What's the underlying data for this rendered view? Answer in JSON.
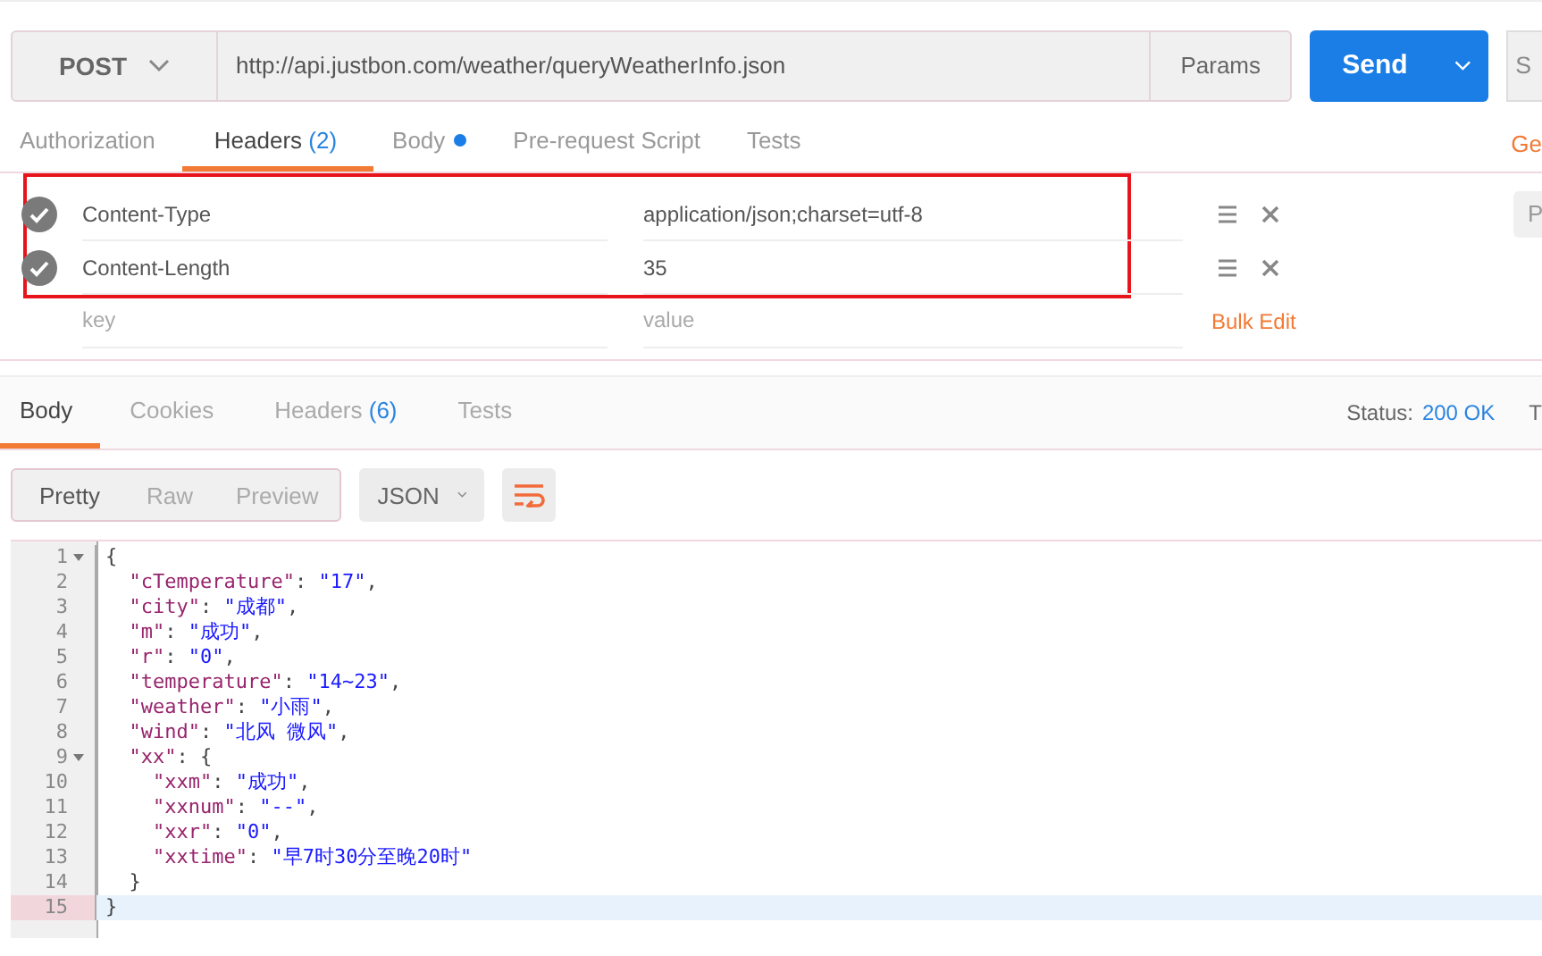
{
  "request": {
    "method": "POST",
    "url": "http://api.justbon.com/weather/queryWeatherInfo.json",
    "params_button": "Params",
    "send_button": "Send",
    "cut_button": "S"
  },
  "request_tabs": [
    {
      "label": "Authorization",
      "selected": false
    },
    {
      "label": "Headers",
      "count": "(2)",
      "selected": true
    },
    {
      "label": "Body",
      "dot": true,
      "selected": false
    },
    {
      "label": "Pre-request Script",
      "selected": false
    },
    {
      "label": "Tests",
      "selected": false
    }
  ],
  "generate_link": "Ge",
  "headers": [
    {
      "key": "Content-Type",
      "value": "application/json;charset=utf-8",
      "checked": true
    },
    {
      "key": "Content-Length",
      "value": "35",
      "checked": true
    }
  ],
  "new_header": {
    "key_placeholder": "key",
    "value_placeholder": "value"
  },
  "bulk_edit": "Bulk Edit",
  "side_button": "P",
  "response_tabs": [
    {
      "label": "Body",
      "selected": true
    },
    {
      "label": "Cookies",
      "selected": false
    },
    {
      "label": "Headers",
      "count": "(6)",
      "selected": false
    },
    {
      "label": "Tests",
      "selected": false
    }
  ],
  "status": {
    "label": "Status:",
    "value": "200 OK",
    "cut": "T"
  },
  "view_modes": [
    {
      "label": "Pretty",
      "selected": true
    },
    {
      "label": "Raw",
      "selected": false
    },
    {
      "label": "Preview",
      "selected": false
    }
  ],
  "format": "JSON",
  "code": [
    {
      "number": "1",
      "foldable": true,
      "selected": false,
      "tokens": [
        {
          "kind": "punct",
          "text": "{"
        }
      ]
    },
    {
      "number": "2",
      "foldable": false,
      "selected": false,
      "tokens": [
        {
          "kind": "key",
          "text": "  \"cTemperature\""
        },
        {
          "kind": "punct",
          "text": ": "
        },
        {
          "kind": "string",
          "text": "\"17\""
        },
        {
          "kind": "punct",
          "text": ","
        }
      ]
    },
    {
      "number": "3",
      "foldable": false,
      "selected": false,
      "tokens": [
        {
          "kind": "key",
          "text": "  \"city\""
        },
        {
          "kind": "punct",
          "text": ": "
        },
        {
          "kind": "string",
          "text": "\"成都\""
        },
        {
          "kind": "punct",
          "text": ","
        }
      ]
    },
    {
      "number": "4",
      "foldable": false,
      "selected": false,
      "tokens": [
        {
          "kind": "key",
          "text": "  \"m\""
        },
        {
          "kind": "punct",
          "text": ": "
        },
        {
          "kind": "string",
          "text": "\"成功\""
        },
        {
          "kind": "punct",
          "text": ","
        }
      ]
    },
    {
      "number": "5",
      "foldable": false,
      "selected": false,
      "tokens": [
        {
          "kind": "key",
          "text": "  \"r\""
        },
        {
          "kind": "punct",
          "text": ": "
        },
        {
          "kind": "string",
          "text": "\"0\""
        },
        {
          "kind": "punct",
          "text": ","
        }
      ]
    },
    {
      "number": "6",
      "foldable": false,
      "selected": false,
      "tokens": [
        {
          "kind": "key",
          "text": "  \"temperature\""
        },
        {
          "kind": "punct",
          "text": ": "
        },
        {
          "kind": "string",
          "text": "\"14~23\""
        },
        {
          "kind": "punct",
          "text": ","
        }
      ]
    },
    {
      "number": "7",
      "foldable": false,
      "selected": false,
      "tokens": [
        {
          "kind": "key",
          "text": "  \"weather\""
        },
        {
          "kind": "punct",
          "text": ": "
        },
        {
          "kind": "string",
          "text": "\"小雨\""
        },
        {
          "kind": "punct",
          "text": ","
        }
      ]
    },
    {
      "number": "8",
      "foldable": false,
      "selected": false,
      "tokens": [
        {
          "kind": "key",
          "text": "  \"wind\""
        },
        {
          "kind": "punct",
          "text": ": "
        },
        {
          "kind": "string",
          "text": "\"北风 微风\""
        },
        {
          "kind": "punct",
          "text": ","
        }
      ]
    },
    {
      "number": "9",
      "foldable": true,
      "selected": false,
      "tokens": [
        {
          "kind": "key",
          "text": "  \"xx\""
        },
        {
          "kind": "punct",
          "text": ": {"
        }
      ]
    },
    {
      "number": "10",
      "foldable": false,
      "selected": false,
      "tokens": [
        {
          "kind": "key",
          "text": "    \"xxm\""
        },
        {
          "kind": "punct",
          "text": ": "
        },
        {
          "kind": "string",
          "text": "\"成功\""
        },
        {
          "kind": "punct",
          "text": ","
        }
      ]
    },
    {
      "number": "11",
      "foldable": false,
      "selected": false,
      "tokens": [
        {
          "kind": "key",
          "text": "    \"xxnum\""
        },
        {
          "kind": "punct",
          "text": ": "
        },
        {
          "kind": "string",
          "text": "\"--\""
        },
        {
          "kind": "punct",
          "text": ","
        }
      ]
    },
    {
      "number": "12",
      "foldable": false,
      "selected": false,
      "tokens": [
        {
          "kind": "key",
          "text": "    \"xxr\""
        },
        {
          "kind": "punct",
          "text": ": "
        },
        {
          "kind": "string",
          "text": "\"0\""
        },
        {
          "kind": "punct",
          "text": ","
        }
      ]
    },
    {
      "number": "13",
      "foldable": false,
      "selected": false,
      "tokens": [
        {
          "kind": "key",
          "text": "    \"xxtime\""
        },
        {
          "kind": "punct",
          "text": ": "
        },
        {
          "kind": "string",
          "text": "\"早7时30分至晚20时\""
        }
      ]
    },
    {
      "number": "14",
      "foldable": false,
      "selected": false,
      "tokens": [
        {
          "kind": "punct",
          "text": "  }"
        }
      ]
    },
    {
      "number": "15",
      "foldable": false,
      "selected": true,
      "tokens": [
        {
          "kind": "punct",
          "text": "}"
        }
      ]
    }
  ]
}
